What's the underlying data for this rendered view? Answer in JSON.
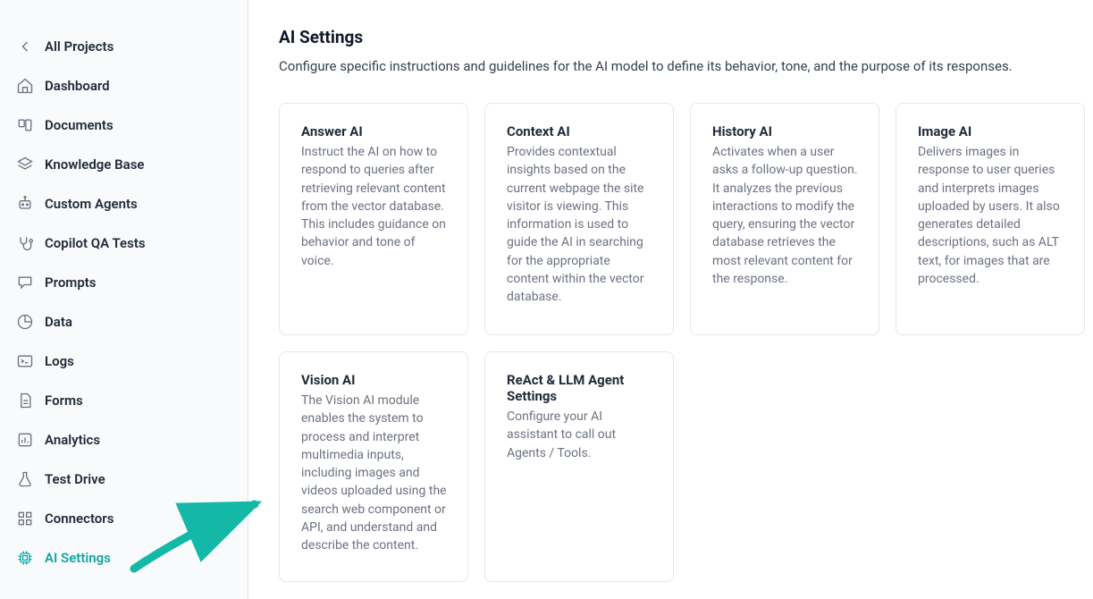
{
  "sidebar": {
    "items": [
      {
        "label": "All Projects"
      },
      {
        "label": "Dashboard"
      },
      {
        "label": "Documents"
      },
      {
        "label": "Knowledge Base"
      },
      {
        "label": "Custom Agents"
      },
      {
        "label": "Copilot QA Tests"
      },
      {
        "label": "Prompts"
      },
      {
        "label": "Data"
      },
      {
        "label": "Logs"
      },
      {
        "label": "Forms"
      },
      {
        "label": "Analytics"
      },
      {
        "label": "Test Drive"
      },
      {
        "label": "Connectors"
      },
      {
        "label": "AI Settings"
      }
    ]
  },
  "main": {
    "title": "AI Settings",
    "description": "Configure specific instructions and guidelines for the AI model to define its behavior, tone, and the purpose of its responses.",
    "cards": [
      {
        "title": "Answer AI",
        "desc": "Instruct the AI on how to respond to queries after retrieving relevant content from the vector database. This includes guidance on behavior and tone of voice."
      },
      {
        "title": "Context AI",
        "desc": "Provides contextual insights based on the current webpage the site visitor is viewing. This information is used to guide the AI in searching for the appropriate content within the vector database."
      },
      {
        "title": "History AI",
        "desc": "Activates when a user asks a follow-up question. It analyzes the previous interactions to modify the query, ensuring the vector database retrieves the most relevant content for the response."
      },
      {
        "title": "Image AI",
        "desc": "Delivers images in response to user queries and interprets images uploaded by users. It also generates detailed descriptions, such as ALT text, for images that are processed."
      },
      {
        "title": "Vision AI",
        "desc": "The Vision AI module enables the system to process and interpret multimedia inputs, including images and videos uploaded using the search web component or API, and understand and describe the content."
      },
      {
        "title": "ReAct & LLM Agent Settings",
        "desc": "Configure your AI assistant to call out Agents / Tools."
      }
    ]
  }
}
